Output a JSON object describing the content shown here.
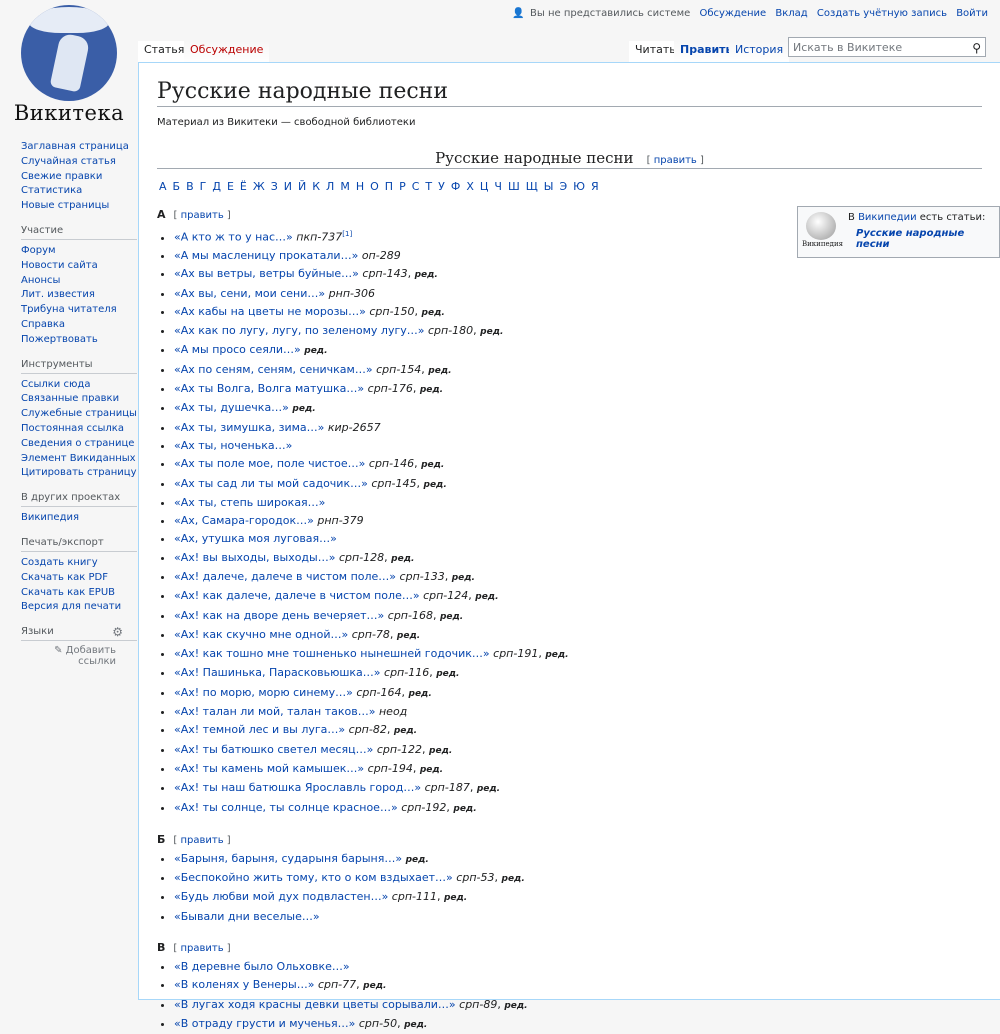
{
  "logo": {
    "title": "Викитека"
  },
  "personal": {
    "anon": "Вы не представились системе",
    "talk": "Обсуждение",
    "contrib": "Вклад",
    "create": "Создать учётную запись",
    "login": "Войти"
  },
  "tabs": {
    "article": "Статья",
    "talk": "Обсуждение",
    "read": "Читать",
    "edit": "Править",
    "history": "История"
  },
  "search": {
    "placeholder": "Искать в Викитеке"
  },
  "sidebar": {
    "nav": [
      "Заглавная страница",
      "Случайная статья",
      "Свежие правки",
      "Статистика",
      "Новые страницы"
    ],
    "participation": {
      "title": "Участие",
      "items": [
        "Форум",
        "Новости сайта",
        "Анонсы",
        "Лит. известия",
        "Трибуна читателя",
        "Справка",
        "Пожертвовать"
      ]
    },
    "tools": {
      "title": "Инструменты",
      "items": [
        "Ссылки сюда",
        "Связанные правки",
        "Служебные страницы",
        "Постоянная ссылка",
        "Сведения о странице",
        "Элемент Викиданных",
        "Цитировать страницу"
      ]
    },
    "projects": {
      "title": "В других проектах",
      "items": [
        "Википедия"
      ]
    },
    "print": {
      "title": "Печать/экспорт",
      "items": [
        "Создать книгу",
        "Скачать как PDF",
        "Скачать как EPUB",
        "Версия для печати"
      ]
    },
    "langs": {
      "title": "Языки",
      "add": "Добавить ссылки"
    }
  },
  "page": {
    "title": "Русские народные песни",
    "tagline": "Материал из Викитеки — свободной библиотеки",
    "header": "Русские народные песни",
    "edit_label": "править",
    "alphabet": [
      "А",
      "Б",
      "В",
      "Г",
      "Д",
      "Е",
      "Ё",
      "Ж",
      "З",
      "И",
      "Й",
      "К",
      "Л",
      "М",
      "Н",
      "О",
      "П",
      "Р",
      "С",
      "Т",
      "У",
      "Ф",
      "Х",
      "Ц",
      "Ч",
      "Ш",
      "Щ",
      "Ы",
      "Э",
      "Ю",
      "Я"
    ],
    "sections": [
      {
        "letter": "А",
        "items": [
          {
            "t": "«А кто ж то у нас…»",
            "c": "пкп-737",
            "sup": "[1]"
          },
          {
            "t": "«А мы масленицу прокатали…»",
            "c": "оп-289"
          },
          {
            "t": "«Ах вы ветры, ветры буйные…»",
            "c": "срп-143",
            "e": "ред."
          },
          {
            "t": "«Ах вы, сени, мои сени…»",
            "c": "рнп-306"
          },
          {
            "t": "«Ах кабы на цветы не морозы…»",
            "c": "срп-150",
            "e": "ред."
          },
          {
            "t": "«Ах как по лугу, лугу, по зеленому лугу…»",
            "c": "срп-180",
            "e": "ред."
          },
          {
            "t": "«А мы просо сеяли…»",
            "e": "ред."
          },
          {
            "t": "«Ах по сеням, сеням, сеничкам…»",
            "c": "срп-154",
            "e": "ред."
          },
          {
            "t": "«Ах ты Волга, Волга матушка…»",
            "c": "срп-176",
            "e": "ред."
          },
          {
            "t": "«Ах ты, душечка…»",
            "e": "ред."
          },
          {
            "t": "«Ах ты, зимушка, зима…»",
            "c": "кир-2657"
          },
          {
            "t": "«Ах ты, ноченька…»"
          },
          {
            "t": "«Ах ты поле мое, поле чистое…»",
            "c": "срп-146",
            "e": "ред."
          },
          {
            "t": "«Ах ты сад ли ты мой садочик…»",
            "c": "срп-145",
            "e": "ред."
          },
          {
            "t": "«Ах ты, степь широкая…»"
          },
          {
            "t": "«Ах, Самара-городок…»",
            "c": "рнп-379"
          },
          {
            "t": "«Ах, утушка моя луговая…»"
          },
          {
            "t": "«Ах! вы выходы, выходы…»",
            "c": "срп-128",
            "e": "ред."
          },
          {
            "t": "«Ах! далече, далече в чистом поле…»",
            "c": "срп-133",
            "e": "ред."
          },
          {
            "t": "«Ах! как далече, далече в чистом поле…»",
            "c": "срп-124",
            "e": "ред."
          },
          {
            "t": "«Ах! как на дворе день вечеряет…»",
            "c": "срп-168",
            "e": "ред."
          },
          {
            "t": "«Ах! как скучно мне одной…»",
            "c": "срп-78",
            "e": "ред."
          },
          {
            "t": "«Ах! как тошно мне тошненько нынешней годочик…»",
            "c": "срп-191",
            "e": "ред."
          },
          {
            "t": "«Ах! Пашинька, Парасковьюшка…»",
            "c": "срп-116",
            "e": "ред."
          },
          {
            "t": "«Ах! по морю, морю синему…»",
            "c": "срп-164",
            "e": "ред."
          },
          {
            "t": "«Ах! талан ли мой, талан таков…»",
            "c": "неод"
          },
          {
            "t": "«Ах! темной лес и вы луга…»",
            "c": "срп-82",
            "e": "ред."
          },
          {
            "t": "«Ах! ты батюшко светел месяц…»",
            "c": "срп-122",
            "e": "ред."
          },
          {
            "t": "«Ах! ты камень мой камышек…»",
            "c": "срп-194",
            "e": "ред."
          },
          {
            "t": "«Ах! ты наш батюшка Ярославль город…»",
            "c": "срп-187",
            "e": "ред."
          },
          {
            "t": "«Ах! ты солнце, ты солнце красное…»",
            "c": "срп-192",
            "e": "ред."
          }
        ]
      },
      {
        "letter": "Б",
        "items": [
          {
            "t": "«Барыня, барыня, сударыня барыня…»",
            "e": "ред."
          },
          {
            "t": "«Беспокойно жить тому, кто о ком вздыхает…»",
            "c": "срп-53",
            "e": "ред."
          },
          {
            "t": "«Будь любви мой дух подвластен…»",
            "c": "срп-111",
            "e": "ред."
          },
          {
            "t": "«Бывали дни веселые…»"
          }
        ]
      },
      {
        "letter": "В",
        "items": [
          {
            "t": "«В деревне было Ольховке…»"
          },
          {
            "t": "«В коленях у Венеры…»",
            "c": "срп-77",
            "e": "ред."
          },
          {
            "t": "«В лугах ходя красны девки цветы сорывали…»",
            "c": "срп-89",
            "e": "ред."
          },
          {
            "t": "«В отраду грусти и мученья…»",
            "c": "срп-50",
            "e": "ред."
          }
        ]
      }
    ],
    "wikibox": {
      "pre": "В",
      "link": "Википедии",
      "post": "есть статьи:",
      "article": "Русские народные песни",
      "logo_text": "Википедия"
    }
  }
}
